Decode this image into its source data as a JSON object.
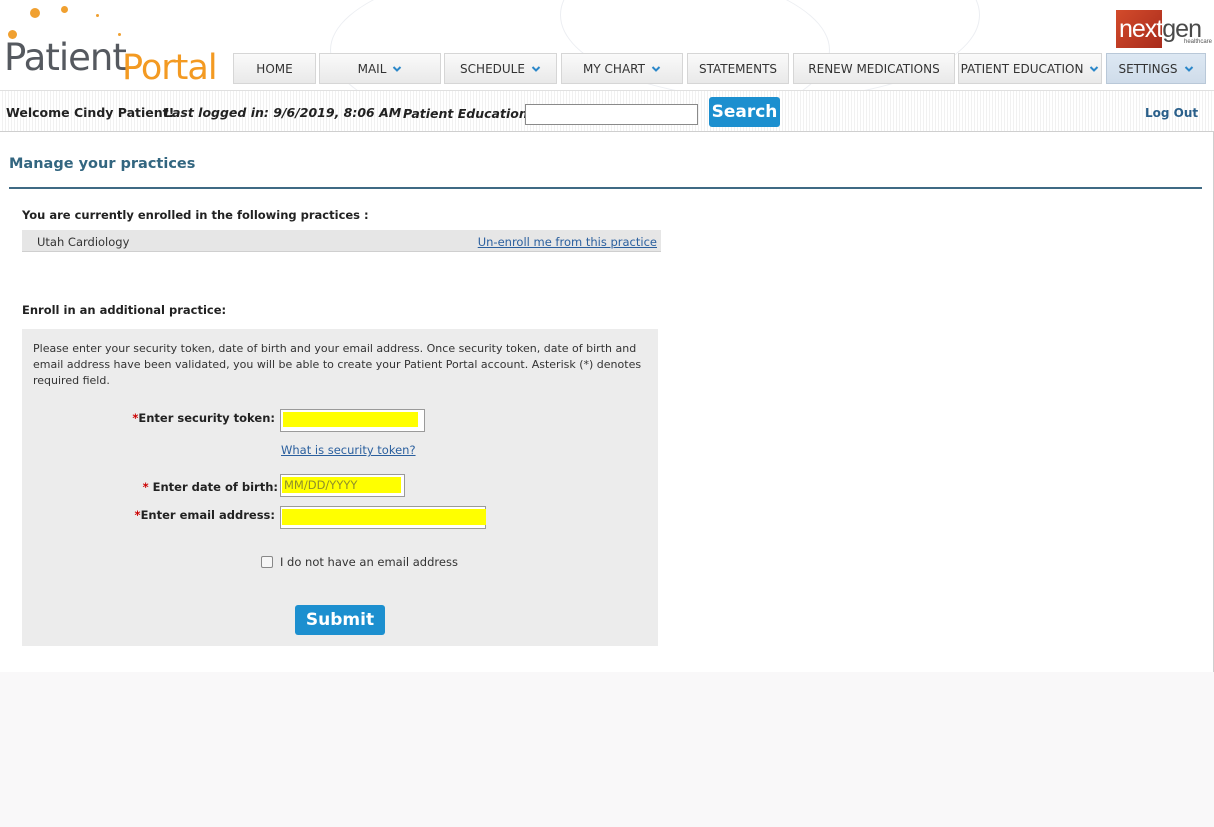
{
  "brand": {
    "logo_word1": "Patient",
    "logo_word2": "Portal",
    "partner_logo_text1": "next",
    "partner_logo_text2": "gen",
    "partner_logo_sub": "healthcare",
    "accent_color": "#1c8fcf",
    "logo_orange": "#f39a22"
  },
  "nav": {
    "items": [
      {
        "label": "HOME",
        "has_dropdown": false
      },
      {
        "label": "MAIL",
        "has_dropdown": true
      },
      {
        "label": "SCHEDULE",
        "has_dropdown": true
      },
      {
        "label": "MY CHART",
        "has_dropdown": true
      },
      {
        "label": "STATEMENTS",
        "has_dropdown": false
      },
      {
        "label": "RENEW MEDICATIONS",
        "has_dropdown": false
      },
      {
        "label": "PATIENT EDUCATION",
        "has_dropdown": true
      },
      {
        "label": "SETTINGS",
        "has_dropdown": true
      }
    ]
  },
  "welcome": {
    "greeting": "Welcome Cindy Patient!",
    "last_logged": "Last logged in: 9/6/2019, 8:06 AM",
    "patient_education_label": "Patient Education",
    "search_value": "",
    "search_button": "Search",
    "logout": "Log Out"
  },
  "main": {
    "page_title": "Manage your practices",
    "enrolled_label": "You are currently enrolled in the following practices :",
    "practices": [
      {
        "name": "Utah Cardiology",
        "action": "Un-enroll me from this practice"
      }
    ],
    "enroll_label": "Enroll in an additional practice:",
    "instructions": "Please enter your security token, date of birth and your email address. Once security token, date of birth and email address have been validated, you will be able to create your Patient Portal account. Asterisk (*) denotes required field.",
    "form": {
      "required_marker": "*",
      "token_label": "Enter security token:",
      "token_value": "",
      "token_help": "What is security token?",
      "dob_label": " Enter date of birth:",
      "dob_placeholder": "MM/DD/YYYY",
      "email_label": "Enter email address:",
      "email_value": "",
      "no_email_label": "I do not have an email address",
      "no_email_checked": false,
      "submit": "Submit"
    }
  }
}
